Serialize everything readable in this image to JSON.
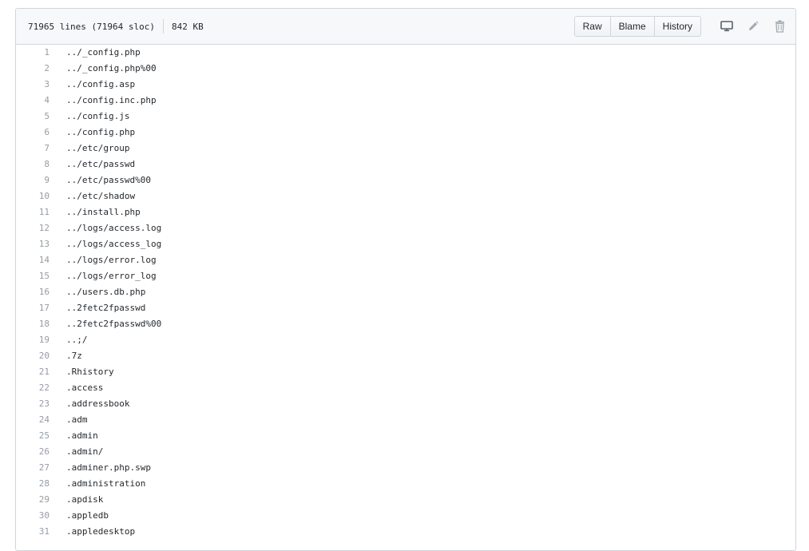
{
  "header": {
    "lines_info": "71965 lines (71964 sloc)",
    "size": "842 KB",
    "buttons": {
      "raw": "Raw",
      "blame": "Blame",
      "history": "History"
    },
    "icons": [
      "desktop-icon",
      "pencil-icon",
      "trash-icon"
    ]
  },
  "lines": [
    "../_config.php",
    "../_config.php%00",
    "../config.asp",
    "../config.inc.php",
    "../config.js",
    "../config.php",
    "../etc/group",
    "../etc/passwd",
    "../etc/passwd%00",
    "../etc/shadow",
    "../install.php",
    "../logs/access.log",
    "../logs/access_log",
    "../logs/error.log",
    "../logs/error_log",
    "../users.db.php",
    "..2fetc2fpasswd",
    "..2fetc2fpasswd%00",
    "..;/",
    ".7z",
    ".Rhistory",
    ".access",
    ".addressbook",
    ".adm",
    ".admin",
    ".admin/",
    ".adminer.php.swp",
    ".administration",
    ".apdisk",
    ".appledb",
    ".appledesktop"
  ]
}
